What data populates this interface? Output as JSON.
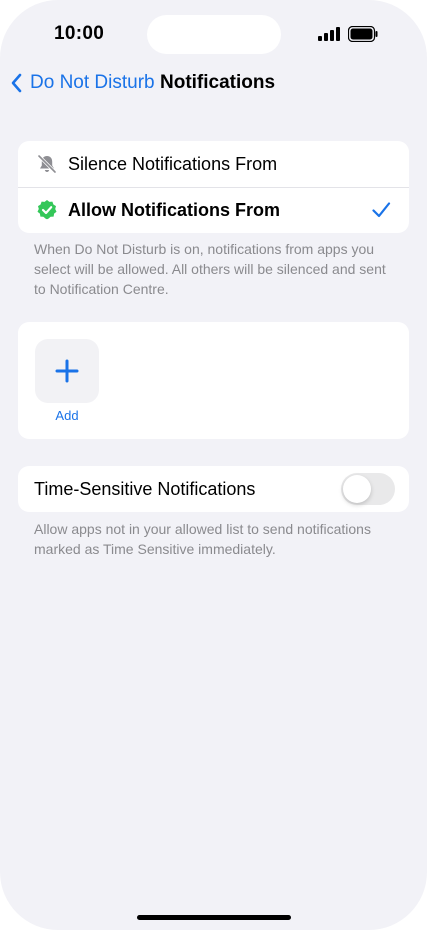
{
  "status_bar": {
    "time": "10:00"
  },
  "nav": {
    "back_label": "Do Not Disturb",
    "title": "Notifications"
  },
  "mode_options": [
    {
      "label": "Silence Notifications From",
      "icon": "bell-slash-icon",
      "selected": false
    },
    {
      "label": "Allow Notifications From",
      "icon": "verified-badge-icon",
      "selected": true
    }
  ],
  "mode_footnote": "When Do Not Disturb is on, notifications from apps you select will be allowed. All others will be silenced and sent to Notification Centre.",
  "apps": {
    "add_label": "Add"
  },
  "time_sensitive": {
    "label": "Time-Sensitive Notifications",
    "enabled": false,
    "footnote": "Allow apps not in your allowed list to send notifications marked as Time Sensitive immediately."
  },
  "colors": {
    "accent": "#1a73e8",
    "badge_green": "#34c759",
    "background": "#f2f2f7"
  }
}
